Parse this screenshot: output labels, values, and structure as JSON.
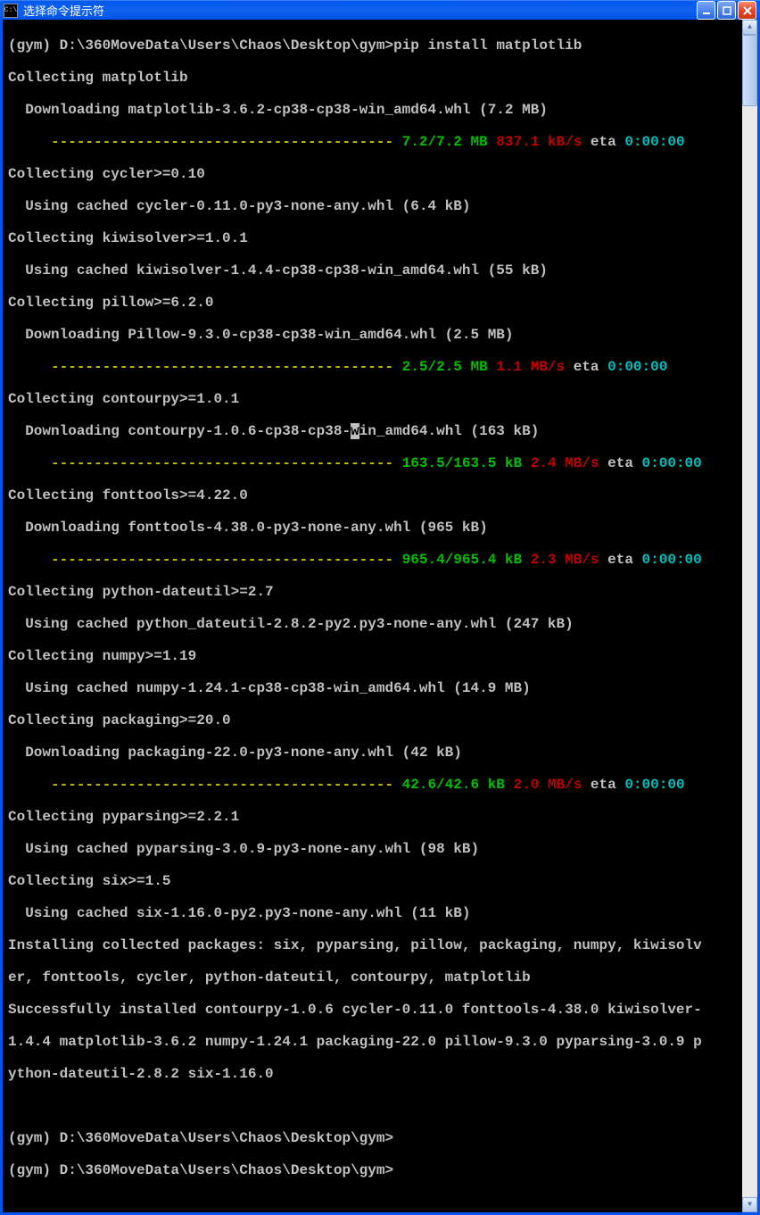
{
  "title": "选择命令提示符",
  "prompt_env": "(gym)",
  "prompt_path": "D:\\360MoveData\\Users\\Chaos\\Desktop\\gym>",
  "cmd": "pip install matplotlib",
  "l01": "Collecting matplotlib",
  "l02": "  Downloading matplotlib-3.6.2-cp38-cp38-win_amd64.whl (7.2 MB)",
  "p1_dash": "     ---------------------------------------- ",
  "p1_prog": "7.2/7.2 MB",
  "p1_speed": " 837.1 kB/s",
  "p1_eta": " eta ",
  "p1_time": "0:00:00",
  "l03": "Collecting cycler>=0.10",
  "l04": "  Using cached cycler-0.11.0-py3-none-any.whl (6.4 kB)",
  "l05": "Collecting kiwisolver>=1.0.1",
  "l06": "  Using cached kiwisolver-1.4.4-cp38-cp38-win_amd64.whl (55 kB)",
  "l07": "Collecting pillow>=6.2.0",
  "l08": "  Downloading Pillow-9.3.0-cp38-cp38-win_amd64.whl (2.5 MB)",
  "p2_dash": "     ---------------------------------------- ",
  "p2_prog": "2.5/2.5 MB",
  "p2_speed": " 1.1 MB/s",
  "p2_eta": " eta ",
  "p2_time": "0:00:00",
  "l09": "Collecting contourpy>=1.0.1",
  "l10a": "  Downloading contourpy-1.0.6-cp38-cp38-",
  "l10b": "w",
  "l10c": "in_amd64.whl (163 kB)",
  "p3_dash": "     ---------------------------------------- ",
  "p3_prog": "163.5/163.5 kB",
  "p3_speed": " 2.4 MB/s",
  "p3_eta": " eta ",
  "p3_time": "0:00:00",
  "l11": "Collecting fonttools>=4.22.0",
  "l12": "  Downloading fonttools-4.38.0-py3-none-any.whl (965 kB)",
  "p4_dash": "     ---------------------------------------- ",
  "p4_prog": "965.4/965.4 kB",
  "p4_speed": " 2.3 MB/s",
  "p4_eta": " eta ",
  "p4_time": "0:00:00",
  "l13": "Collecting python-dateutil>=2.7",
  "l14": "  Using cached python_dateutil-2.8.2-py2.py3-none-any.whl (247 kB)",
  "l15": "Collecting numpy>=1.19",
  "l16": "  Using cached numpy-1.24.1-cp38-cp38-win_amd64.whl (14.9 MB)",
  "l17": "Collecting packaging>=20.0",
  "l18": "  Downloading packaging-22.0-py3-none-any.whl (42 kB)",
  "p5_dash": "     ---------------------------------------- ",
  "p5_prog": "42.6/42.6 kB",
  "p5_speed": " 2.0 MB/s",
  "p5_eta": " eta ",
  "p5_time": "0:00:00",
  "l19": "Collecting pyparsing>=2.2.1",
  "l20": "  Using cached pyparsing-3.0.9-py3-none-any.whl (98 kB)",
  "l21": "Collecting six>=1.5",
  "l22": "  Using cached six-1.16.0-py2.py3-none-any.whl (11 kB)",
  "l23": "Installing collected packages: six, pyparsing, pillow, packaging, numpy, kiwisolv",
  "l24": "er, fonttools, cycler, python-dateutil, contourpy, matplotlib",
  "l25": "Successfully installed contourpy-1.0.6 cycler-0.11.0 fonttools-4.38.0 kiwisolver-",
  "l26": "1.4.4 matplotlib-3.6.2 numpy-1.24.1 packaging-22.0 pillow-9.3.0 pyparsing-3.0.9 p",
  "l27": "ython-dateutil-2.8.2 six-1.16.0",
  "blank": "",
  "prompt2": "(gym) D:\\360MoveData\\Users\\Chaos\\Desktop\\gym>",
  "prompt3": "(gym) D:\\360MoveData\\Users\\Chaos\\Desktop\\gym>"
}
